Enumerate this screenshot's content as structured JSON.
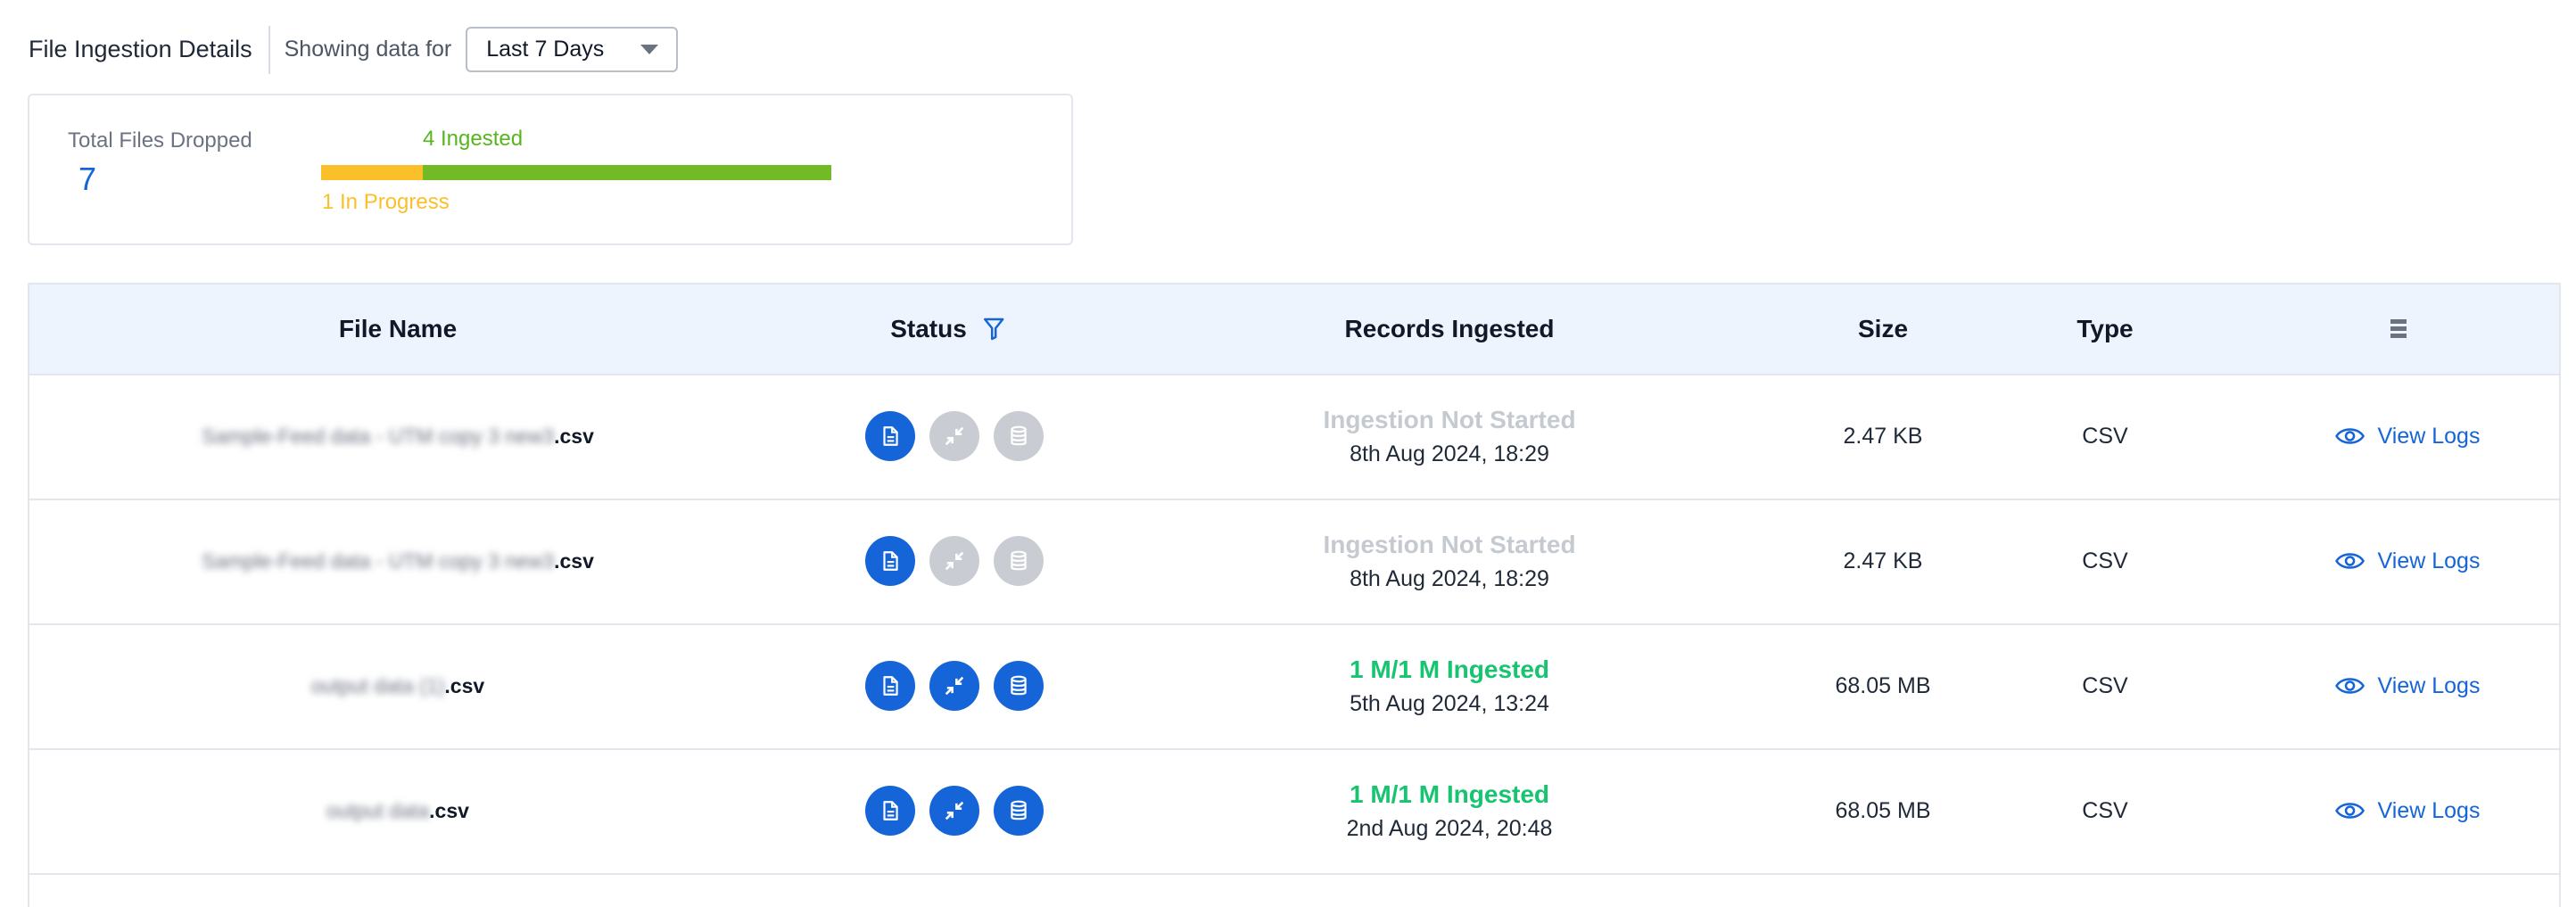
{
  "header": {
    "title": "File Ingestion Details",
    "showing_label": "Showing data for",
    "range_select": "Last 7 Days"
  },
  "summary": {
    "total_label": "Total Files Dropped",
    "total_value": "7",
    "ingested_label": "4 Ingested",
    "in_progress_label": "1 In Progress",
    "in_progress_fraction": 0.2,
    "ingested_fraction": 0.8,
    "colors": {
      "ingested": "#73bb26",
      "in_progress": "#fbbf2a"
    }
  },
  "table": {
    "columns": {
      "file_name": "File Name",
      "status": "Status",
      "records": "Records Ingested",
      "size": "Size",
      "type": "Type"
    },
    "rows": [
      {
        "file_blur": "Sample-Feed data - UTM copy 3 new3",
        "file_ext": ".csv",
        "steps": [
          "on",
          "off",
          "off"
        ],
        "records_status": "Ingestion Not Started",
        "records_state": "pending",
        "date": "8th Aug 2024, 18:29",
        "size": "2.47 KB",
        "type": "CSV",
        "action": "View Logs"
      },
      {
        "file_blur": "Sample-Feed data - UTM copy 3 new3",
        "file_ext": ".csv",
        "steps": [
          "on",
          "off",
          "off"
        ],
        "records_status": "Ingestion Not Started",
        "records_state": "pending",
        "date": "8th Aug 2024, 18:29",
        "size": "2.47 KB",
        "type": "CSV",
        "action": "View Logs"
      },
      {
        "file_blur": "output data (1)",
        "file_ext": ".csv",
        "steps": [
          "on",
          "on",
          "on"
        ],
        "records_status": "1 M/1 M Ingested",
        "records_state": "done",
        "date": "5th Aug 2024, 13:24",
        "size": "68.05 MB",
        "type": "CSV",
        "action": "View Logs"
      },
      {
        "file_blur": "output data",
        "file_ext": ".csv",
        "steps": [
          "on",
          "on",
          "on"
        ],
        "records_status": "1 M/1 M Ingested",
        "records_state": "done",
        "date": "2nd Aug 2024, 20:48",
        "size": "68.05 MB",
        "type": "CSV",
        "action": "View Logs"
      }
    ]
  },
  "icons": {
    "status_steps": [
      "document-icon",
      "compress-arrows-icon",
      "database-icon"
    ],
    "filter": "filter-icon",
    "columns_menu": "column-menu-icon",
    "view": "eye-icon"
  },
  "colors": {
    "accent": "#1565d8",
    "success": "#17c46f",
    "pending": "#c5cad1",
    "header_bg": "#edf4fe"
  }
}
